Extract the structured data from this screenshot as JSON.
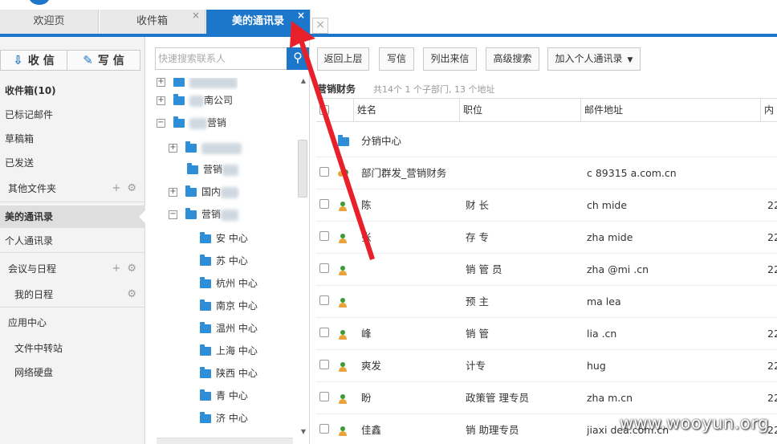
{
  "tabs": [
    {
      "label": "欢迎页",
      "closable": false,
      "active": false
    },
    {
      "label": "收件箱",
      "closable": true,
      "active": false
    },
    {
      "label": "美的通讯录",
      "closable": true,
      "active": true
    }
  ],
  "tab_close_glyph": "×",
  "sidebar": {
    "receive_label": "收 信",
    "compose_label": "写 信",
    "items": [
      {
        "label": "收件箱(10)"
      },
      {
        "label": "已标记邮件"
      },
      {
        "label": "草稿箱"
      },
      {
        "label": "已发送"
      },
      {
        "label": "其他文件夹"
      },
      {
        "label": "美的通讯录"
      },
      {
        "label": "个人通讯录"
      },
      {
        "label": "会议与日程"
      },
      {
        "label": "我的日程"
      },
      {
        "label": "应用中心"
      },
      {
        "label": "文件中转站"
      },
      {
        "label": "网络硬盘"
      }
    ]
  },
  "tree": {
    "search_placeholder": "快速搜索联系人",
    "nodes": [
      {
        "label": "南公司"
      },
      {
        "label": "营销"
      },
      {
        "label": "营销"
      },
      {
        "label": "国内"
      },
      {
        "label": "营销"
      },
      {
        "label": "安 中心"
      },
      {
        "label": "苏 中心"
      },
      {
        "label": "杭州 中心"
      },
      {
        "label": "南京 中心"
      },
      {
        "label": "温州 中心"
      },
      {
        "label": "上海 中心"
      },
      {
        "label": "陕西 中心"
      },
      {
        "label": "青 中心"
      },
      {
        "label": "济 中心"
      }
    ]
  },
  "toolbar": {
    "back": "返回上层",
    "write": "写信",
    "list": "列出来信",
    "advanced": "高级搜索",
    "add_personal": "加入个人通讯录"
  },
  "breadcrumb": {
    "title": "营销财务",
    "summary": "共14个 1 个子部门, 13 个地址"
  },
  "table": {
    "columns": [
      "姓名",
      "职位",
      "邮件地址",
      "内"
    ],
    "rows": [
      {
        "kind": "folder",
        "name": "分销中心",
        "title": "",
        "email": "",
        "extra": ""
      },
      {
        "kind": "group",
        "name": "部门群发_营销财务",
        "title": "",
        "email": "c 89315 a.com.cn",
        "extra": ""
      },
      {
        "kind": "person",
        "name": "陈",
        "title": "财 长",
        "email": "ch mide",
        "extra": "22"
      },
      {
        "kind": "person",
        "name": "张",
        "title": "存 专",
        "email": "zha mide",
        "extra": "22"
      },
      {
        "kind": "person",
        "name": "",
        "title": "销 管 员",
        "email": "zha @mi .cn",
        "extra": "22"
      },
      {
        "kind": "person",
        "name": "",
        "title": "预 主",
        "email": "ma lea",
        "extra": ""
      },
      {
        "kind": "person",
        "name": "峰",
        "title": "销 管",
        "email": "lia .cn",
        "extra": "22"
      },
      {
        "kind": "person",
        "name": "爽发",
        "title": "计专",
        "email": "hug",
        "extra": "22"
      },
      {
        "kind": "person",
        "name": "盼",
        "title": "政策管 理专员",
        "email": "zha m.cn",
        "extra": "22"
      },
      {
        "kind": "person",
        "name": "佳鑫",
        "title": "销 助理专员",
        "email": "jiaxi dea.com.cn",
        "extra": "22"
      }
    ]
  },
  "watermark": "www.wooyun.org",
  "colors": {
    "accent": "#1c76c9",
    "annotation_arrow": "#e8202a"
  }
}
